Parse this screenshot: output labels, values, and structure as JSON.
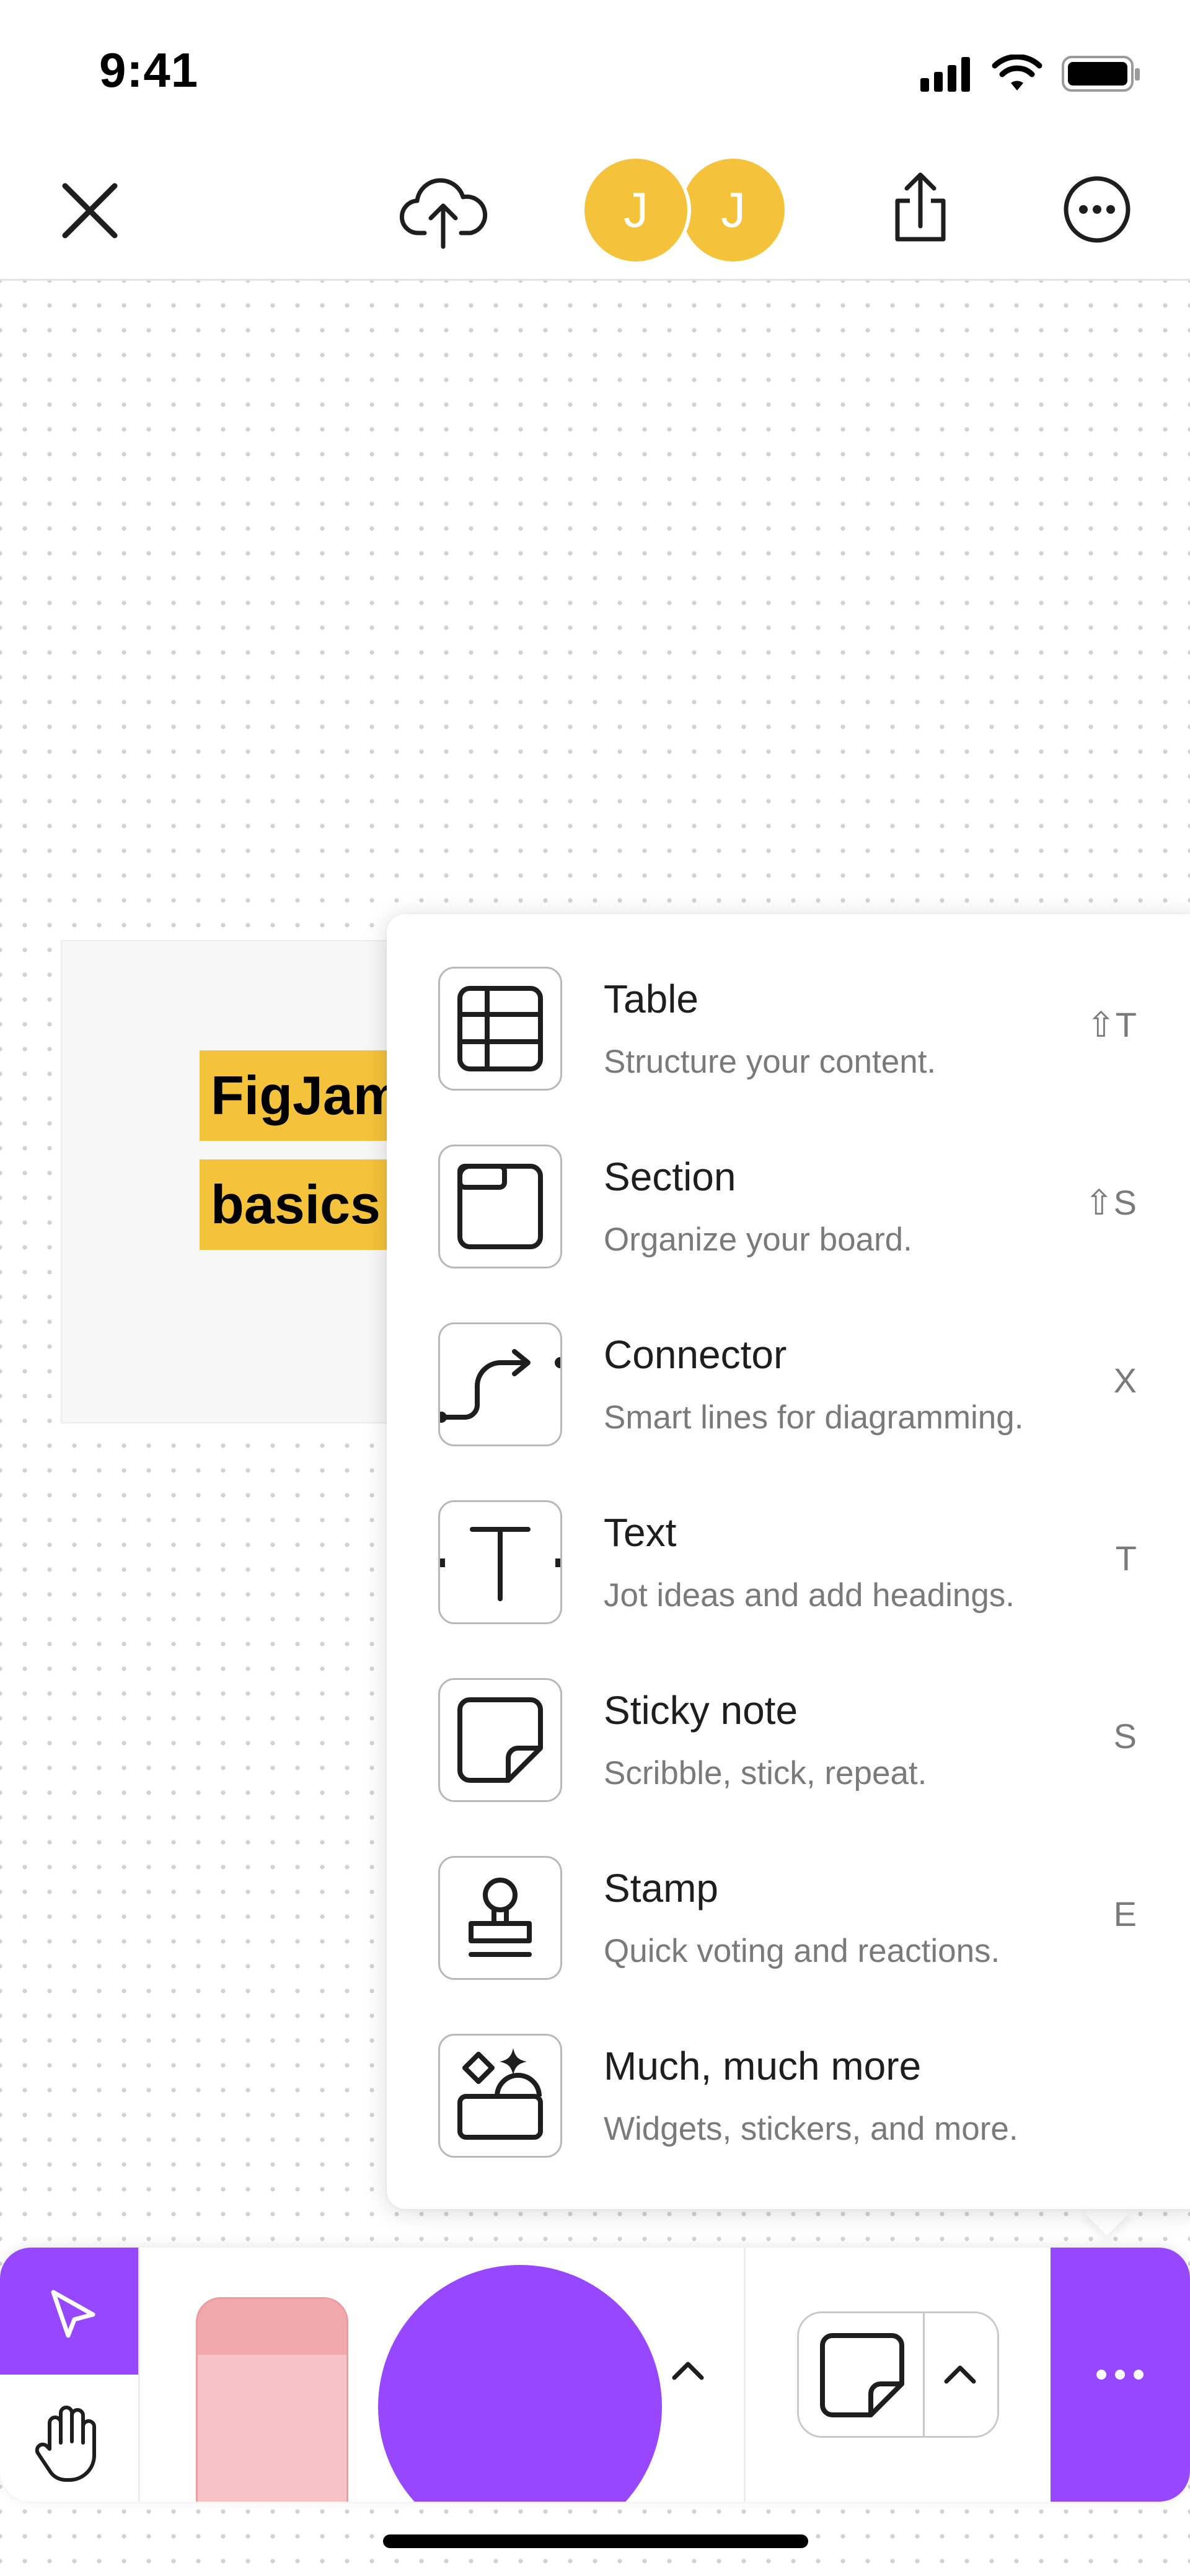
{
  "status_bar": {
    "time": "9:41",
    "icons": [
      "signal-icon",
      "wifi-icon",
      "battery-icon"
    ]
  },
  "top_toolbar": {
    "icons": [
      "close-icon",
      "cloud-upload-icon",
      "share-icon",
      "more-icon"
    ],
    "avatars": [
      {
        "initial": "J",
        "color": "#f5c33b"
      },
      {
        "initial": "J",
        "color": "#f5c33b"
      }
    ]
  },
  "canvas": {
    "frame_labels": [
      "FigJam",
      "basics"
    ]
  },
  "menu": {
    "items": [
      {
        "title": "Table",
        "description": "Structure your content.",
        "shortcut": "⇧T",
        "icon": "table-icon"
      },
      {
        "title": "Section",
        "description": "Organize your board.",
        "shortcut": "⇧S",
        "icon": "section-icon"
      },
      {
        "title": "Connector",
        "description": "Smart lines for diagramming.",
        "shortcut": "X",
        "icon": "connector-icon"
      },
      {
        "title": "Text",
        "description": "Jot ideas and add headings.",
        "shortcut": "T",
        "icon": "text-icon"
      },
      {
        "title": "Sticky note",
        "description": "Scribble, stick, repeat.",
        "shortcut": "S",
        "icon": "sticky-note-icon"
      },
      {
        "title": "Stamp",
        "description": "Quick voting and reactions.",
        "shortcut": "E",
        "icon": "stamp-icon"
      },
      {
        "title": "Much, much more",
        "description": "Widgets, stickers, and more.",
        "shortcut": "",
        "icon": "shapes-more-icon"
      }
    ]
  },
  "bottom_toolbar": {
    "tools": [
      "select-tool",
      "hand-tool",
      "eraser-tool",
      "color-circle",
      "sticky-note-tool",
      "more-tools"
    ],
    "accent_color": "#9747ff",
    "eraser_color": "#f7c3c6"
  }
}
